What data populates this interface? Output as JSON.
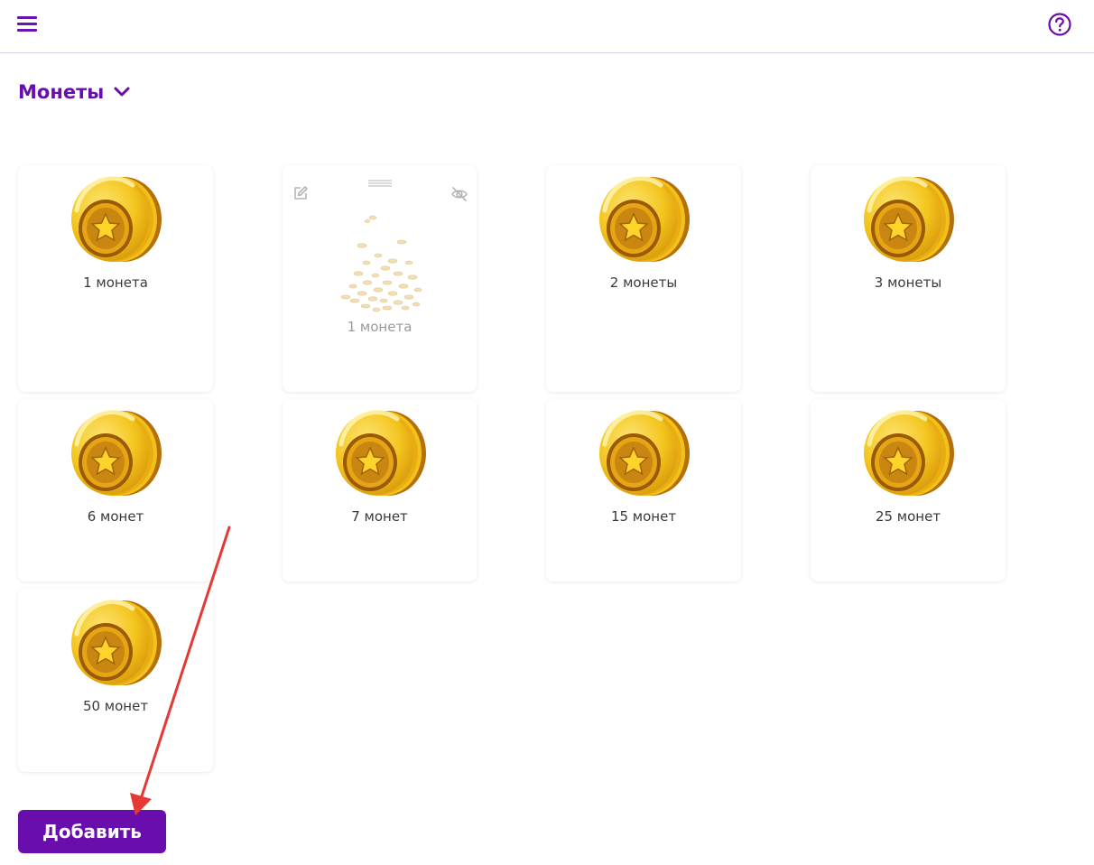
{
  "header": {
    "menu_icon": "hamburger-menu-icon",
    "help_icon": "question-circle-icon"
  },
  "section": {
    "title": "Монеты",
    "chevron_icon": "chevron-down-icon"
  },
  "cards": [
    {
      "label": "1 монета",
      "icon": "gold-coin-icon",
      "hidden": false
    },
    {
      "label": "1 монета",
      "icon": "scattered-coins-icon",
      "hidden": true
    },
    {
      "label": "2 монеты",
      "icon": "gold-coin-icon",
      "hidden": false
    },
    {
      "label": "3 монеты",
      "icon": "gold-coin-icon",
      "hidden": false
    },
    {
      "label": "6 монет",
      "icon": "gold-coin-icon",
      "hidden": false
    },
    {
      "label": "7 монет",
      "icon": "gold-coin-icon",
      "hidden": false
    },
    {
      "label": "15 монет",
      "icon": "gold-coin-icon",
      "hidden": false
    },
    {
      "label": "25 монет",
      "icon": "gold-coin-icon",
      "hidden": false
    },
    {
      "label": "50 монет",
      "icon": "gold-coin-icon",
      "hidden": false
    }
  ],
  "card_actions": {
    "edit_icon": "pencil-edit-icon",
    "drag_icon": "drag-handle-icon",
    "visibility_icon": "eye-off-icon"
  },
  "add_button": {
    "label": "Добавить"
  },
  "colors": {
    "accent": "#6a0dad",
    "annotation_arrow": "#e53935"
  }
}
